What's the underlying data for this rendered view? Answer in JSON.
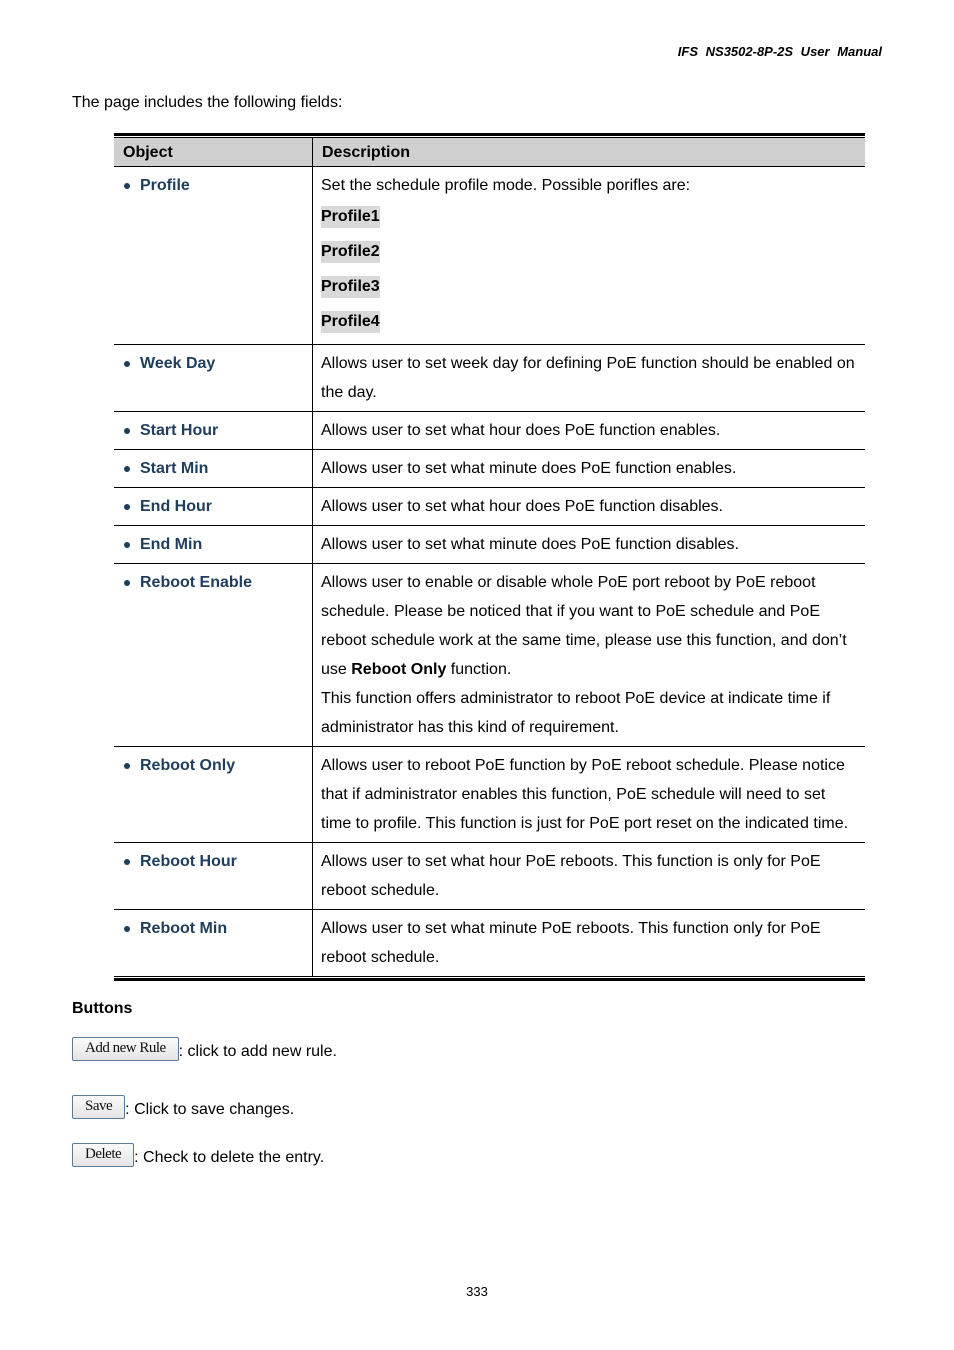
{
  "header": {
    "title": "IFS  NS3502-8P-2S  User  Manual"
  },
  "intro": "The page includes the following fields:",
  "table": {
    "headers": {
      "object": "Object",
      "description": "Description"
    },
    "rows": [
      {
        "object": "Profile",
        "description": [
          "Set the schedule profile mode. Possible porifles are:"
        ],
        "options": [
          "Profile1",
          "Profile2",
          "Profile3",
          "Profile4"
        ]
      },
      {
        "object": "Week Day",
        "description": [
          "Allows user to set week day for defining PoE function should be enabled on the day."
        ]
      },
      {
        "object": "Start Hour",
        "description": [
          "Allows user to set what hour does PoE function enables."
        ]
      },
      {
        "object": "Start Min",
        "description": [
          "Allows user to set what minute does PoE function enables."
        ]
      },
      {
        "object": "End Hour",
        "description": [
          "Allows user to set what hour does PoE function disables."
        ]
      },
      {
        "object": "End Min",
        "description": [
          "Allows user to set what minute does PoE function disables."
        ]
      },
      {
        "object": "Reboot Enable",
        "description_parts": {
          "pre": "Allows user to enable or disable whole PoE port reboot by PoE reboot schedule. Please be noticed that if you want to PoE schedule and PoE reboot schedule work at the same time, please use this function, and don’t use ",
          "bold": "Reboot Only",
          "post": " function.",
          "extra": "This function offers administrator to reboot PoE device at indicate time if administrator has this kind of requirement."
        }
      },
      {
        "object": "Reboot Only",
        "description": [
          "Allows user to reboot PoE function by PoE reboot schedule. Please notice that if administrator enables this function, PoE schedule will need to set time to profile. This function is just for PoE port reset on the indicated time."
        ]
      },
      {
        "object": "Reboot Hour",
        "description": [
          "Allows user to set what hour PoE reboots. This function is only for PoE reboot schedule."
        ]
      },
      {
        "object": "Reboot Min",
        "description": [
          "Allows user to set what minute PoE reboots. This function only for PoE reboot schedule."
        ]
      }
    ]
  },
  "buttons_section": {
    "title": "Buttons",
    "items": [
      {
        "label": "Add new Rule",
        "text": ": click to add new rule."
      },
      {
        "label": "Save",
        "text": ": Click to save changes."
      },
      {
        "label": "Delete",
        "text": ": Check to delete the entry."
      }
    ]
  },
  "page_number": "333"
}
